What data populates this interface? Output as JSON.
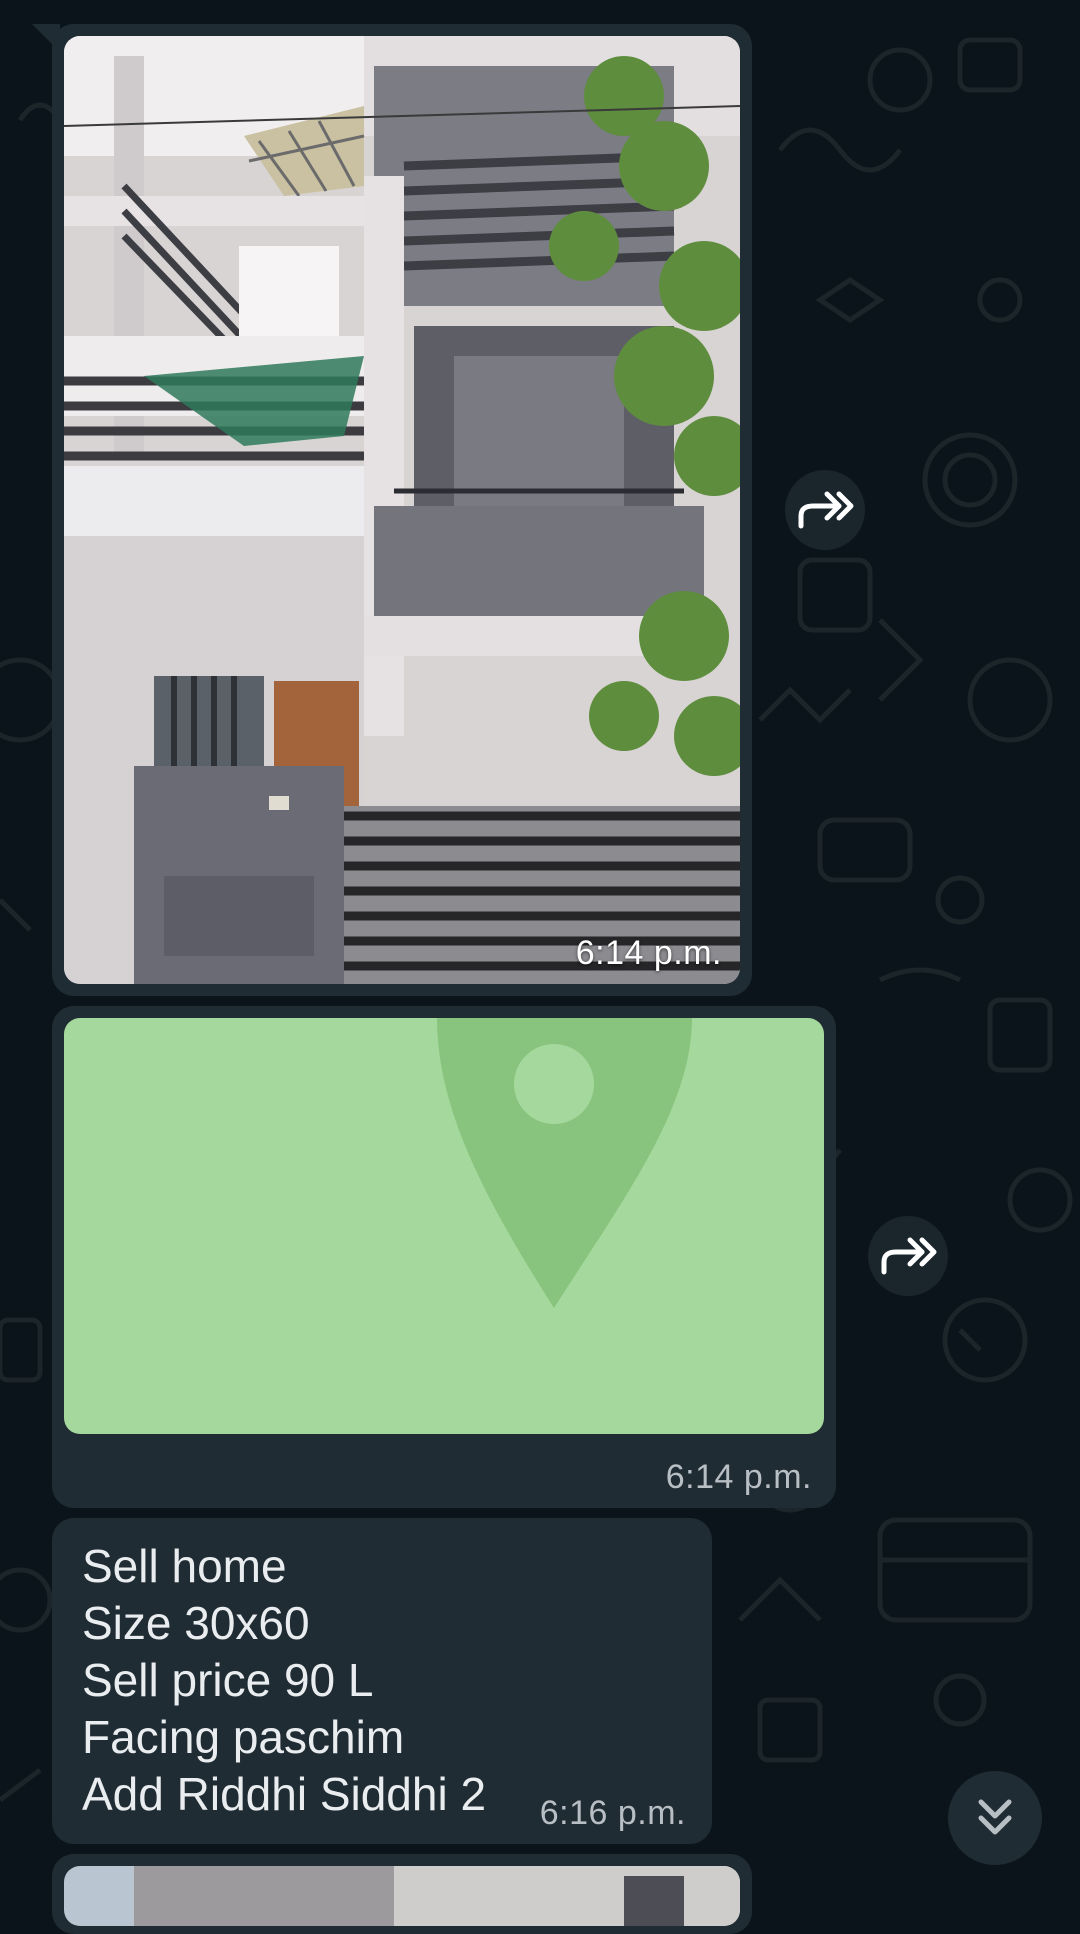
{
  "colors": {
    "chat_background": "#0b141a",
    "incoming_bubble": "#202c33",
    "location_placeholder": "#a5d89c",
    "location_pin": "#88c47e",
    "text": "#e9edef",
    "muted_text": "#b8bfc4"
  },
  "messages": [
    {
      "type": "image",
      "content": "house-photo",
      "time": "6:14 p.m.",
      "forward_icon": "forward-icon"
    },
    {
      "type": "location",
      "content": "location-pin-icon",
      "time": "6:14 p.m.",
      "forward_icon": "forward-icon"
    },
    {
      "type": "text",
      "lines": [
        "Sell home",
        "Size 30x60",
        "Sell price 90 L",
        "Facing paschim",
        "Add Riddhi Siddhi 2"
      ],
      "time": "6:16 p.m."
    },
    {
      "type": "image",
      "content": "house-photo-partial"
    }
  ],
  "scroll_button": {
    "icon": "double-chevron-down-icon"
  }
}
